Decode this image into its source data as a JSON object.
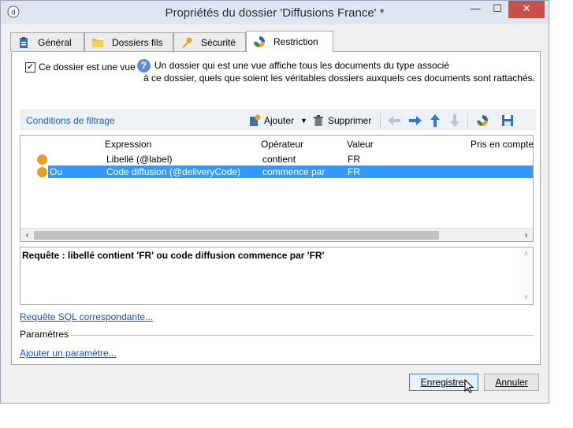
{
  "window": {
    "title": "Propriétés du dossier 'Diffusions France' *"
  },
  "tabs": [
    {
      "label": "Général",
      "icon": "clipboard-icon",
      "active": false
    },
    {
      "label": "Dossiers fils",
      "icon": "folder-icon",
      "active": false
    },
    {
      "label": "Sécurité",
      "icon": "key-icon",
      "active": false
    },
    {
      "label": "Restriction",
      "icon": "filter-icon",
      "active": true
    }
  ],
  "view": {
    "checkbox_label": "Ce dossier est une vue",
    "checked": true,
    "info_line1": "Un dossier qui est une vue affiche tous les documents du type associé",
    "info_line2": "à ce dossier, quels que soient les véritables dossiers auxquels ces documents sont rattachés."
  },
  "filter": {
    "title": "Conditions de filtrage",
    "add_label": "Ajouter",
    "delete_label": "Supprimer"
  },
  "grid": {
    "columns": [
      "Expression",
      "Opérateur",
      "Valeur",
      "Pris en compte"
    ],
    "rows": [
      {
        "prefix": "",
        "expression": "Libellé (@label)",
        "operator": "contient",
        "value": "FR",
        "selected": false
      },
      {
        "prefix": "Ou",
        "expression": "Code diffusion (@deliveryCode)",
        "operator": "commence par",
        "value": "FR",
        "selected": true
      }
    ]
  },
  "query": {
    "text": "Requête : libellé contient 'FR' ou code diffusion commence par 'FR'"
  },
  "links": {
    "sql": "Requête SQL correspondante...",
    "params_label": "Paramètres",
    "add_param": "Ajouter un paramètre..."
  },
  "buttons": {
    "save": "Enregistrer",
    "cancel": "Annuler"
  },
  "colors": {
    "selection": "#3399ff",
    "link": "#1b4fc4",
    "close": "#c7504a"
  }
}
